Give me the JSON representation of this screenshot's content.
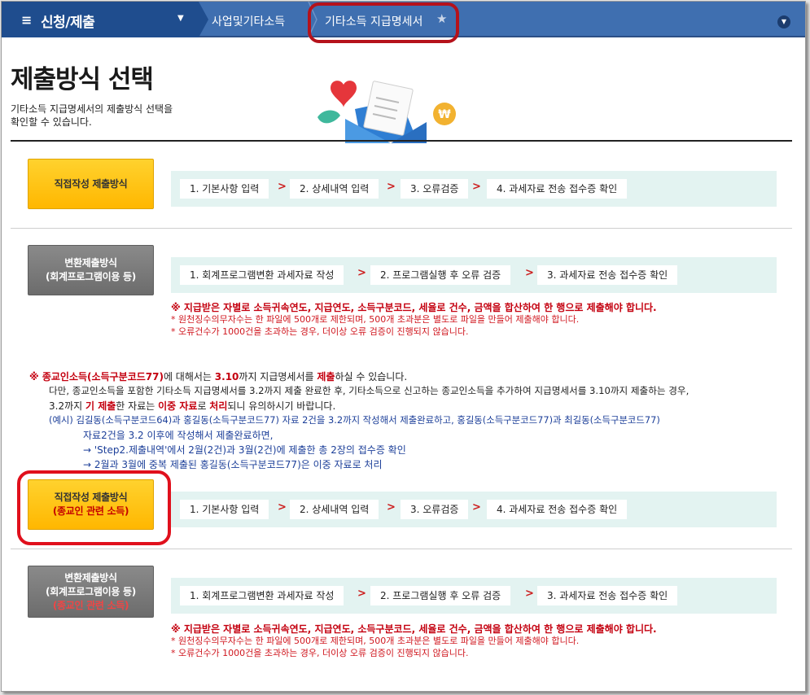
{
  "nav": {
    "menu_icon": "≡",
    "menu_title": "신청/제출",
    "caret": "▼",
    "crumb1": "사업및기타소득",
    "crumb2": "기타소득 지급명세서",
    "star": "★",
    "expand": "▼"
  },
  "header": {
    "title": "제출방식 선택",
    "desc_line1": "기타소득 지급명세서의 제출방식 선택을",
    "desc_line2": "확인할 수 있습니다."
  },
  "steps_direct": [
    "1. 기본사항 입력",
    "2. 상세내역 입력",
    "3. 오류검증",
    "4. 과세자료 전송 접수증 확인"
  ],
  "steps_convert": [
    "1. 회계프로그램변환 과세자료 작성",
    "2. 프로그램실행 후 오류 검증",
    "3. 과세자료 전송 접수증 확인"
  ],
  "arrow": ">",
  "method1": {
    "label": "직접작성 제출방식"
  },
  "method2": {
    "line1": "변환제출방식",
    "line2": "(회계프로그램이용 등)"
  },
  "method3": {
    "line1": "직접작성 제출방식",
    "line2": "(종교인 관련 소득)"
  },
  "method4": {
    "line1": "변환제출방식",
    "line2": "(회계프로그램이용 등)",
    "line3": "(종교인 관련 소득)"
  },
  "notes": {
    "bold": "※ 지급받은 자별로 소득귀속연도, 지급연도, 소득구분코드, 세율로 건수, 금액을 합산하여 한 행으로 제출해야 합니다.",
    "n1": "* 원천징수의무자수는 한 파일에 500개로 제한되며, 500개 초과분은 별도로 파일을 만들어 제출해야 합니다.",
    "n2": "* 오류건수가 1000건을 초과하는 경우, 더이상 오류 검증이 진행되지 않습니다."
  },
  "religion": {
    "l1_a": "※ ",
    "l1_b": "종교인소득(소득구분코드77)",
    "l1_c": "에 대해서는 ",
    "l1_d": "3.10",
    "l1_e": "까지 지급명세서를 ",
    "l1_f": "제출",
    "l1_g": "하실 수 있습니다.",
    "l2": "다만, 종교인소득을 포함한 기타소득 지급명세서를 3.2까지 제출 완료한 후, 기타소득으로 신고하는 종교인소득을 추가하여 지급명세서를 3.10까지 제출하는 경우,",
    "l3_a": "3.2까지 ",
    "l3_b": "기 제출",
    "l3_c": "한 자료는 ",
    "l3_d": "이중 자료",
    "l3_e": "로 ",
    "l3_f": "처리",
    "l3_g": "되니 유의하시기 바랍니다.",
    "l4": "(예시) 김길동(소득구분코드64)과 홍길동(소득구분코드77) 자료 2건을 3.2까지 작성해서 제출완료하고, 홍길동(소득구분코드77)과 최길동(소득구분코드77)",
    "l5": "자료2건을 3.2 이후에 작성해서 제출완료하면,",
    "l6": "→ 'Step2.제출내역'에서 2월(2건)과 3월(2건)에 제출한 총 2장의 접수증 확인",
    "l7": "→ 2월과 3월에 중복 제출된 홍길동(소득구분코드77)은 이중 자료로 처리"
  }
}
